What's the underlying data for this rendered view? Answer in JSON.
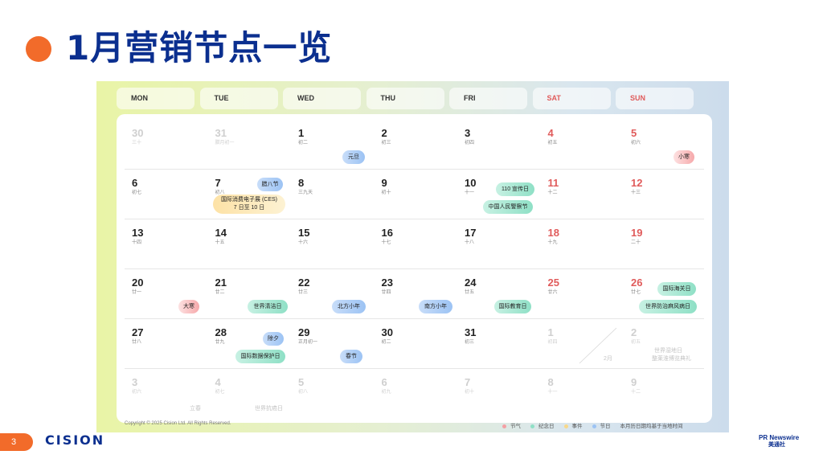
{
  "title": "1月营销节点一览",
  "weekdays": [
    {
      "label": "MON",
      "weekend": false
    },
    {
      "label": "TUE",
      "weekend": false
    },
    {
      "label": "WED",
      "weekend": false
    },
    {
      "label": "THU",
      "weekend": false
    },
    {
      "label": "FRI",
      "weekend": false
    },
    {
      "label": "SAT",
      "weekend": true
    },
    {
      "label": "SUN",
      "weekend": true
    }
  ],
  "weeks": [
    [
      {
        "n": "30",
        "l": "三十",
        "fd": true
      },
      {
        "n": "31",
        "l": "腊月初一",
        "fd": true
      },
      {
        "n": "1",
        "l": "初二"
      },
      {
        "n": "2",
        "l": "初三"
      },
      {
        "n": "3",
        "l": "初四"
      },
      {
        "n": "4",
        "l": "初五"
      },
      {
        "n": "5",
        "l": "初六"
      }
    ],
    [
      {
        "n": "6",
        "l": "初七"
      },
      {
        "n": "7",
        "l": "初八"
      },
      {
        "n": "8",
        "l": "三九天"
      },
      {
        "n": "9",
        "l": "初十"
      },
      {
        "n": "10",
        "l": "十一"
      },
      {
        "n": "11",
        "l": "十二"
      },
      {
        "n": "12",
        "l": "十三"
      }
    ],
    [
      {
        "n": "13",
        "l": "十四"
      },
      {
        "n": "14",
        "l": "十五"
      },
      {
        "n": "15",
        "l": "十六"
      },
      {
        "n": "16",
        "l": "十七"
      },
      {
        "n": "17",
        "l": "十八"
      },
      {
        "n": "18",
        "l": "十九"
      },
      {
        "n": "19",
        "l": "二十"
      }
    ],
    [
      {
        "n": "20",
        "l": "廿一"
      },
      {
        "n": "21",
        "l": "廿二"
      },
      {
        "n": "22",
        "l": "廿三"
      },
      {
        "n": "23",
        "l": "廿四"
      },
      {
        "n": "24",
        "l": "廿五"
      },
      {
        "n": "25",
        "l": "廿六"
      },
      {
        "n": "26",
        "l": "廿七"
      }
    ],
    [
      {
        "n": "27",
        "l": "廿八"
      },
      {
        "n": "28",
        "l": "廿九"
      },
      {
        "n": "29",
        "l": "正月初一"
      },
      {
        "n": "30",
        "l": "初二"
      },
      {
        "n": "31",
        "l": "初三"
      },
      {
        "n": "1",
        "l": "初四",
        "fd": true
      },
      {
        "n": "2",
        "l": "初五",
        "fd": true
      }
    ],
    [
      {
        "n": "3",
        "l": "初六",
        "fd": true
      },
      {
        "n": "4",
        "l": "初七",
        "fd": true
      },
      {
        "n": "5",
        "l": "初八",
        "fd": true
      },
      {
        "n": "6",
        "l": "初九",
        "fd": true
      },
      {
        "n": "7",
        "l": "初十",
        "fd": true
      },
      {
        "n": "8",
        "l": "十一",
        "fd": true
      },
      {
        "n": "9",
        "l": "十二",
        "fd": true
      }
    ]
  ],
  "events": {
    "yuandan": "元旦",
    "xiaohan": "小寒",
    "laba": "腊八节",
    "ces_line1": "国际消费电子展 (CES)",
    "ces_line2": "7 日至 10 日",
    "xuanchuan110": "110 宣传日",
    "police": "中国人民警察节",
    "dahan": "大寒",
    "snow": "世界清洁日",
    "north_new_year": "北方小年",
    "south_new_year": "南方小年",
    "education": "国际教育日",
    "customs": "国际海关日",
    "leprosy": "世界防治麻风病日",
    "chuxi": "除夕",
    "privacy": "国际数据保护日",
    "spring": "春节"
  },
  "ghosts": {
    "feb_month": "2月",
    "feb_event1": "世界湿地日",
    "feb_event2": "整莱淮博览典礼",
    "lichun": "立春",
    "cancer": "世界抗癌日"
  },
  "footer": {
    "copyright": "Copyright © 2025 Cision Ltd. All Rights Reserved.",
    "legend": [
      {
        "label": "节气",
        "color": "#f4a0a4"
      },
      {
        "label": "纪念日",
        "color": "#8fe0c6"
      },
      {
        "label": "事件",
        "color": "#f8d88a"
      },
      {
        "label": "节日",
        "color": "#9cc3f4"
      }
    ],
    "note": "本月历日期均基于当地时间"
  },
  "page_number": "3",
  "brand_left": "CISION",
  "brand_right_line1": "PR Newswire",
  "brand_right_line2": "美通社"
}
